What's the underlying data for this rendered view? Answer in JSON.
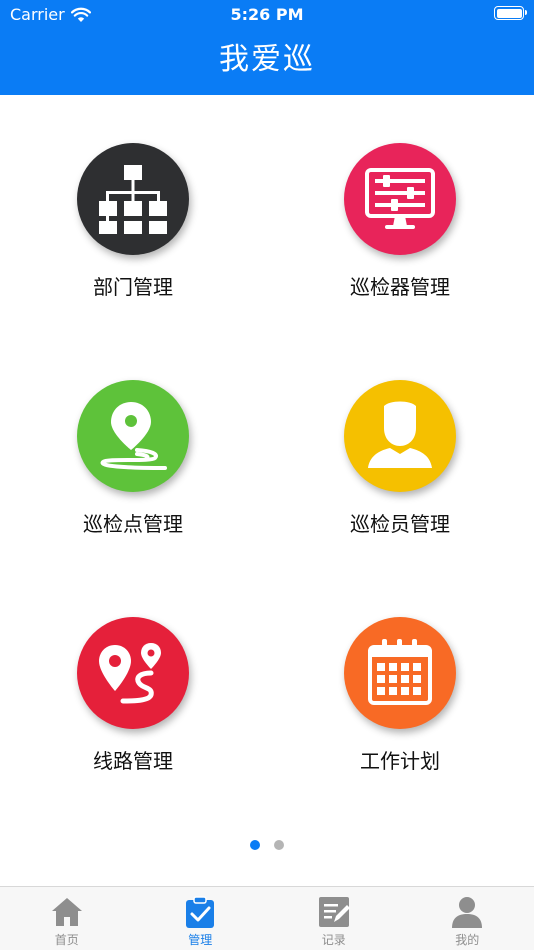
{
  "status_bar": {
    "carrier": "Carrier",
    "time": "5:26 PM"
  },
  "header": {
    "title": "我爱巡"
  },
  "grid": {
    "items": [
      {
        "label": "部门管理",
        "icon": "org-chart-icon",
        "color": "#2e2f31"
      },
      {
        "label": "巡检器管理",
        "icon": "monitor-sliders-icon",
        "color": "#e8245a"
      },
      {
        "label": "巡检点管理",
        "icon": "location-pin-path-icon",
        "color": "#5ec23a"
      },
      {
        "label": "巡检员管理",
        "icon": "inspector-person-icon",
        "color": "#f5c000"
      },
      {
        "label": "线路管理",
        "icon": "route-pins-icon",
        "color": "#e5203a"
      },
      {
        "label": "工作计划",
        "icon": "calendar-icon",
        "color": "#f86a25"
      }
    ]
  },
  "pager": {
    "count": 2,
    "active": 0
  },
  "tabbar": {
    "tabs": [
      {
        "label": "首页",
        "icon": "home-icon",
        "active": false
      },
      {
        "label": "管理",
        "icon": "clipboard-check-icon",
        "active": true
      },
      {
        "label": "记录",
        "icon": "note-edit-icon",
        "active": false
      },
      {
        "label": "我的",
        "icon": "user-icon",
        "active": false
      }
    ],
    "active_color": "#1a7fe8",
    "inactive_color": "#8e8e8e"
  }
}
